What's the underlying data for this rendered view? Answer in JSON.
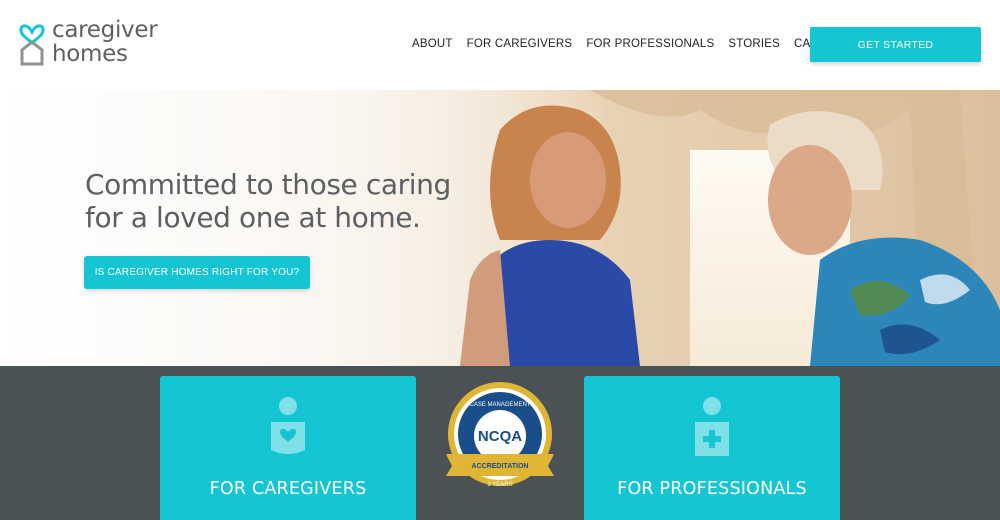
{
  "header": {
    "logo_line1": "caregiver",
    "logo_line2": "homes",
    "nav": [
      "ABOUT",
      "FOR CAREGIVERS",
      "FOR PROFESSIONALS",
      "STORIES",
      "CAREERS"
    ],
    "cta_label": "GET STARTED"
  },
  "hero": {
    "title_line1": "Committed to those caring",
    "title_line2": "for a loved one at home.",
    "button_label": "IS CAREGIVER HOMES RIGHT FOR YOU?"
  },
  "cards": {
    "caregivers_label": "FOR CAREGIVERS",
    "professionals_label": "FOR PROFESSIONALS"
  },
  "badge": {
    "top_text": "CASE MANAGEMENT",
    "center_text": "NCQA",
    "ribbon_text": "ACCREDITATION",
    "bottom_text": "3 YEARS"
  },
  "colors": {
    "accent": "#14c6d3",
    "dark_band": "#4b5256",
    "text_gray": "#5d6063"
  }
}
